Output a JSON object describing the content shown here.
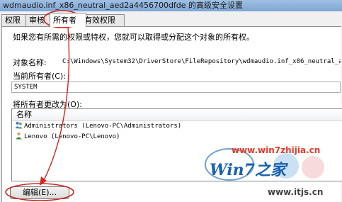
{
  "window": {
    "title": "wdmaudio.inf_x86_neutral_aed2a4456700dfde 的高级安全设置"
  },
  "tabs": [
    {
      "label": "权限"
    },
    {
      "label": "审核"
    },
    {
      "label": "所有者"
    },
    {
      "label": "有效权限"
    }
  ],
  "active_tab": "所有者",
  "owner_panel": {
    "intro": "如果您有所需的权限或特权，您就可以取得或分配这个对象的所有权。",
    "object_name_label": "对象名称:",
    "object_name_value": "C:\\Windows\\System32\\DriverStore\\FileRepository\\wdmaudio.inf_x86_neutral_aed2a445670",
    "current_owner_label": "当前所有者(C):",
    "current_owner_value": "SYSTEM",
    "change_owner_label": "将所有者更改为(O):",
    "list_header": "名称",
    "owners": [
      {
        "name": "Administrators (Lenovo-PC\\Administrators)",
        "icon": "group-users-icon"
      },
      {
        "name": "Lenovo (Lenovo-PC\\Lenovo)",
        "icon": "user-icon"
      }
    ],
    "edit_button": "编辑(E)..."
  },
  "watermark": {
    "url_top": "www.win7zhijia.cn",
    "logo": "Win7之家",
    "url_bottom": "www.itjs.cn"
  },
  "colors": {
    "annotation": "#d0281e",
    "watermark_red": "#e53a2a",
    "watermark_blue": "#1761b0"
  }
}
